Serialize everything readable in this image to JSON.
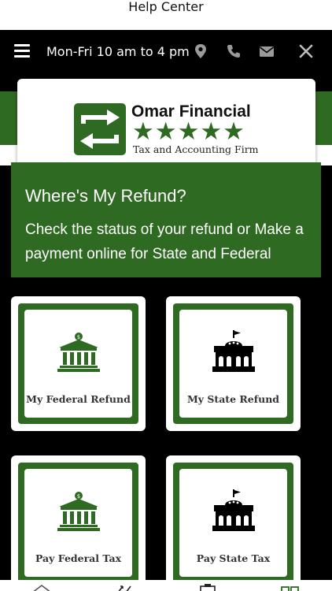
{
  "window": {
    "title": "Help Center"
  },
  "top_bar": {
    "hours": "Mon-Fri 10 am to 4 pm",
    "icons": [
      "menu-icon",
      "location-pin-icon",
      "phone-icon",
      "mail-icon",
      "close-icon"
    ]
  },
  "brand": {
    "name": "Omar Financial",
    "stars": "★★★★★",
    "tagline": "Tax and Accounting Firm"
  },
  "refund": {
    "title": "Where's My Refund?",
    "description": "Check the status of your refund or Make a payment online for State and Federal"
  },
  "tiles": [
    {
      "label": "My Federal Refund",
      "icon": "federal-building-icon"
    },
    {
      "label": "My State Refund",
      "icon": "state-capitol-icon"
    },
    {
      "label": "Pay Federal Tax",
      "icon": "federal-building-icon"
    },
    {
      "label": "Pay State Tax",
      "icon": "state-capitol-icon"
    }
  ],
  "bottom_nav": {
    "icons": [
      "home-icon",
      "share-icon",
      "clipboard-icon",
      "grid-icon"
    ]
  },
  "colors": {
    "brand_green": "#2f6a22",
    "background": "#000000",
    "card": "#ffffff"
  }
}
